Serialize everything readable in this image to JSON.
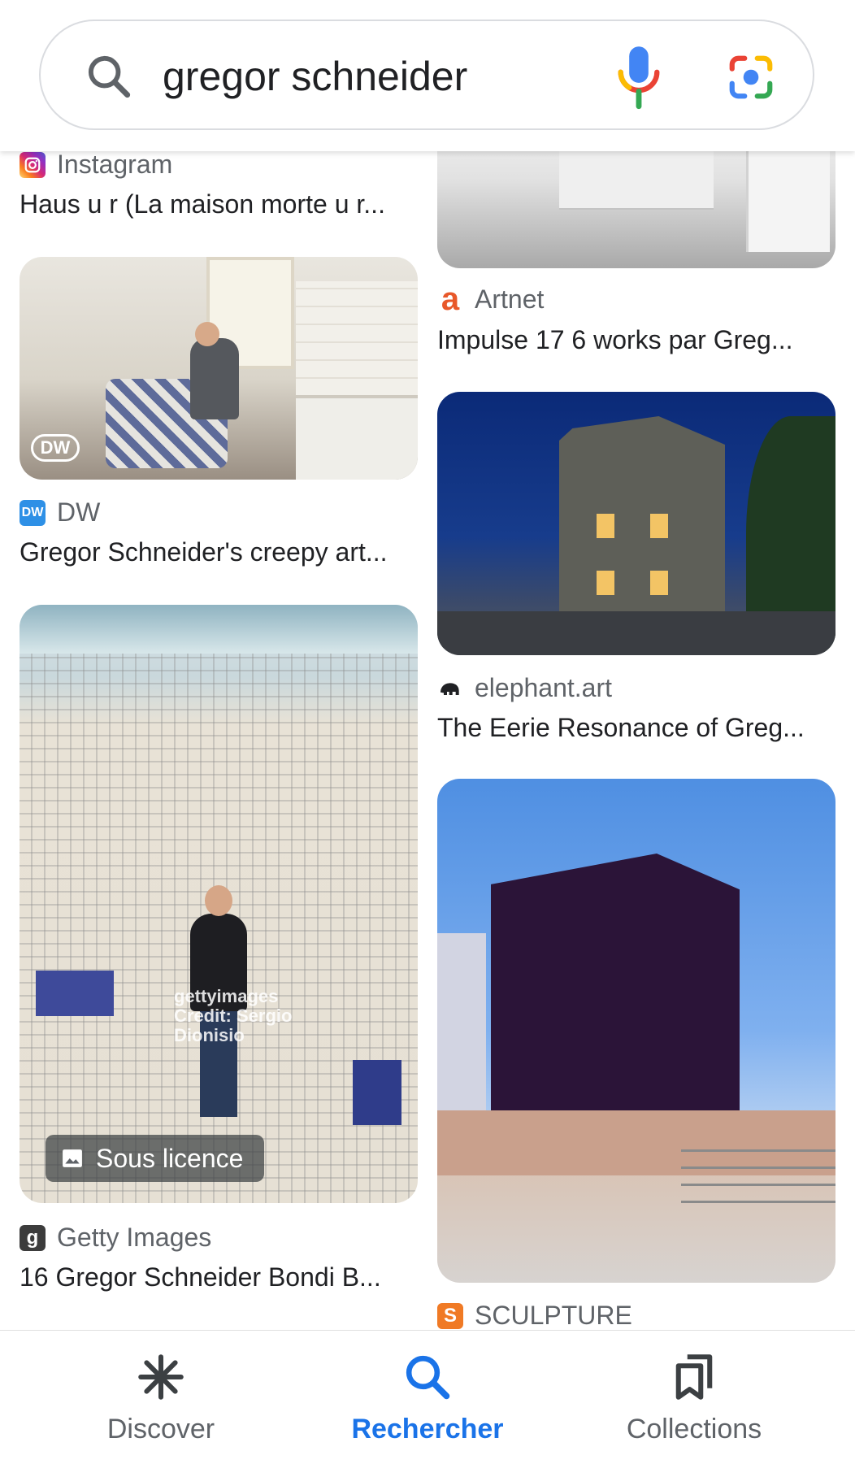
{
  "search": {
    "query": "gregor schneider",
    "icons": [
      "search-icon",
      "mic-icon",
      "lens-icon"
    ]
  },
  "results": {
    "left": [
      {
        "source": "Instagram",
        "title": "Haus u r (La maison morte u r..."
      },
      {
        "source": "DW",
        "title": "Gregor Schneider's creepy art...",
        "image_logo": "DW"
      },
      {
        "source": "Getty Images",
        "title": "16 Gregor Schneider Bondi B...",
        "badge": "Sous licence",
        "watermark": "gettyimages Credit: Sergio Dionisio"
      }
    ],
    "right": [
      {
        "source": "Artnet",
        "title": "Impulse 17 6 works par Greg..."
      },
      {
        "source": "elephant.art",
        "title": "The Eerie Resonance of Greg..."
      },
      {
        "source": "SCULPTURE",
        "title": ""
      }
    ]
  },
  "nav": {
    "items": [
      {
        "label": "Discover",
        "icon": "asterisk-icon"
      },
      {
        "label": "Rechercher",
        "icon": "search-icon",
        "active": true
      },
      {
        "label": "Collections",
        "icon": "bookmarks-icon"
      }
    ]
  },
  "colors": {
    "accent": "#1a73e8",
    "text": "#202124",
    "secondary": "#5f6368"
  }
}
